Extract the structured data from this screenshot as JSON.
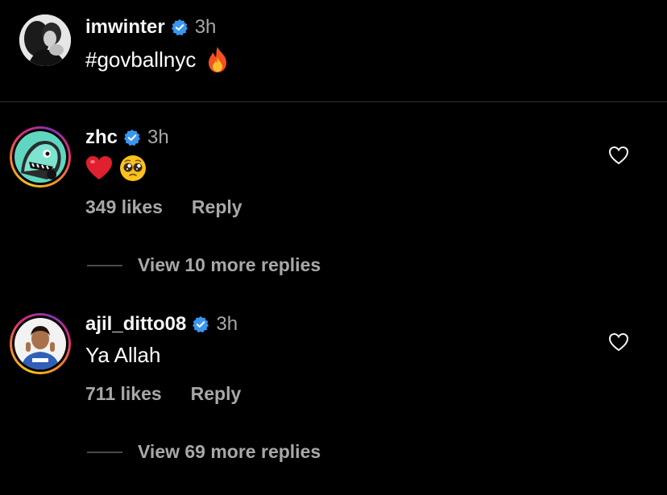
{
  "caption": {
    "username": "imwinter",
    "time": "3h",
    "text": "#govballnyc",
    "emoji_icon": "fire-icon",
    "verified_color": "#3897f0"
  },
  "comments": [
    {
      "username": "zhc",
      "time": "3h",
      "text_emojis": [
        "red-heart-icon",
        "pleading-face-icon"
      ],
      "likes": "349 likes",
      "reply_label": "Reply",
      "view_replies": "View 10 more replies"
    },
    {
      "username": "ajil_ditto08",
      "time": "3h",
      "text": "Ya Allah",
      "likes": "711 likes",
      "reply_label": "Reply",
      "view_replies": "View 69 more replies"
    }
  ],
  "colors": {
    "background": "#000000",
    "primary_text": "#f5f5f5",
    "secondary_text": "#a8a8a8",
    "verified": "#3897f0",
    "divider": "#2e2e2e"
  }
}
